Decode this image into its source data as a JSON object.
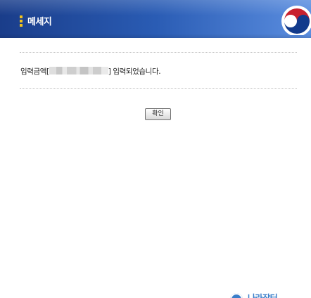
{
  "header": {
    "title": "메세지",
    "colors": {
      "gradient_start": "#1a3d8a",
      "gradient_end": "#5b8ee0",
      "title_mark": "#f2c21c"
    },
    "emblem_icon": "taegeuk-emblem-icon"
  },
  "message": {
    "prefix": "입력금액[",
    "redacted_icon": "blurred-value",
    "suffix": "] 입력되었습니다."
  },
  "actions": {
    "ok_label": "확인"
  },
  "footer": {
    "logo_icon": "government-logo-icon",
    "logo_text": "나라장터"
  }
}
